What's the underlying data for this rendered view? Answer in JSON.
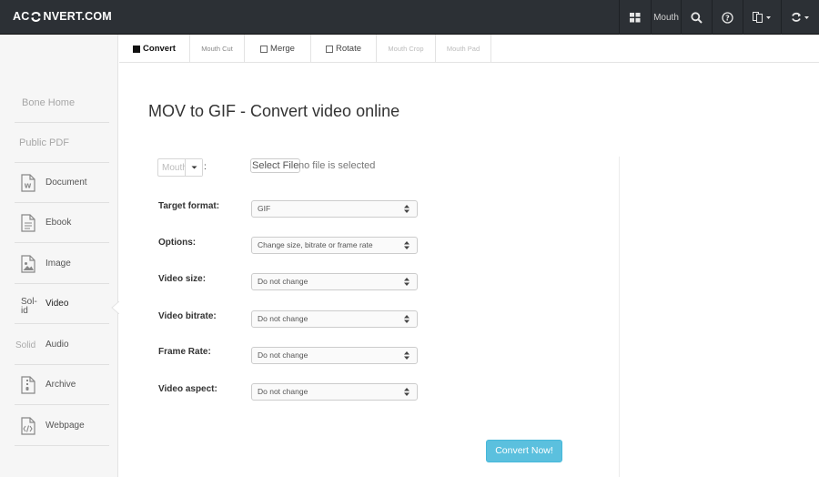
{
  "header": {
    "logo_prefix": "AC",
    "logo_suffix": "NVERT.COM",
    "mouth_label": "Mouth"
  },
  "sidebar": {
    "items": [
      {
        "label": "Bone Home",
        "icon": null
      },
      {
        "label": "Public PDF",
        "icon": null
      },
      {
        "label": "Document",
        "icon": "document-icon"
      },
      {
        "label": "Ebook",
        "icon": "ebook-icon"
      },
      {
        "label": "Image",
        "icon": "image-icon"
      },
      {
        "label": "Video",
        "icon_text": "Sol-id",
        "active": true
      },
      {
        "label": "Audio",
        "icon_text": "Solid"
      },
      {
        "label": "Archive",
        "icon": "archive-icon"
      },
      {
        "label": "Webpage",
        "icon": "webpage-icon"
      }
    ]
  },
  "tabs": [
    {
      "label": "Convert",
      "active": true
    },
    {
      "label": "Mouth Cut"
    },
    {
      "label": "Merge"
    },
    {
      "label": "Rotate"
    },
    {
      "label": "Mouth Crop"
    },
    {
      "label": "Mouth Pad"
    }
  ],
  "main": {
    "title": "MOV to GIF - Convert video online",
    "source_dropdown": "Mouth",
    "colon": ":",
    "select_file": "Select File",
    "no_file": "no file is selected",
    "fields": [
      {
        "label": "Target format:",
        "value": "GIF"
      },
      {
        "label": "Options:",
        "value": "Change size, bitrate or frame rate"
      },
      {
        "label": "Video size:",
        "value": "Do not change"
      },
      {
        "label": "Video bitrate:",
        "value": "Do not change"
      },
      {
        "label": "Frame Rate:",
        "value": "Do not change"
      },
      {
        "label": "Video aspect:",
        "value": "Do not change"
      }
    ],
    "convert_button": "Convert Now!"
  },
  "colors": {
    "topbar": "#2c3035",
    "accent": "#5bc0de",
    "sidebar_bg": "#f6f6f6"
  }
}
